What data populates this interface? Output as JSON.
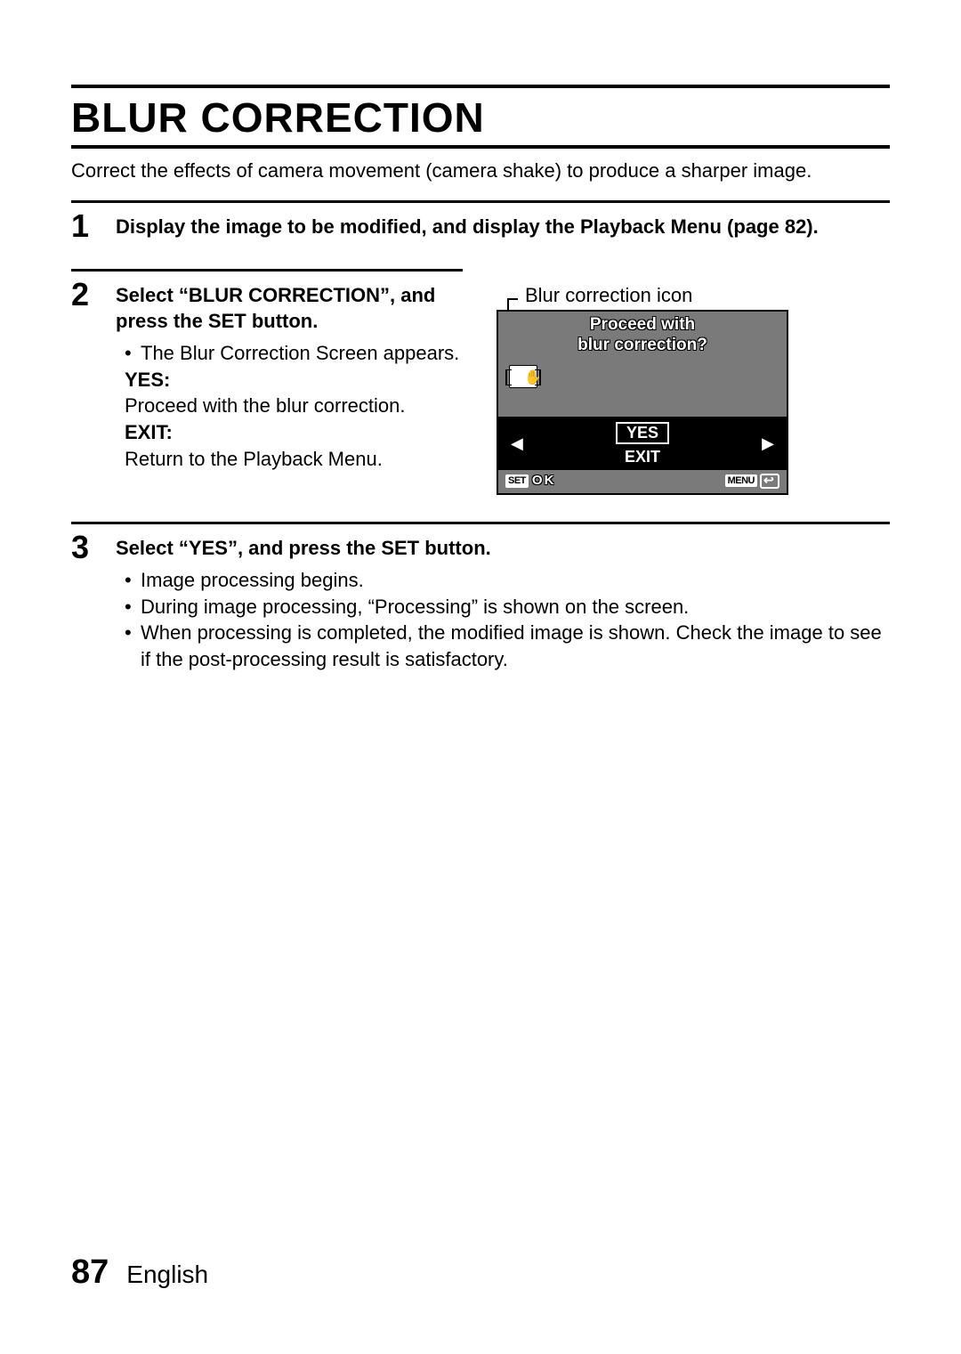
{
  "title": "BLUR CORRECTION",
  "intro": "Correct the effects of camera movement (camera shake) to produce a sharper image.",
  "steps": {
    "s1": {
      "num": "1",
      "heading": "Display the image to be modified, and display the Playback Menu (page 82)."
    },
    "s2": {
      "num": "2",
      "heading": "Select “BLUR CORRECTION”, and press the SET button.",
      "bullet1": "The Blur Correction Screen appears.",
      "yes_label": "YES:",
      "yes_text": "Proceed with the blur correction.",
      "exit_label": "EXIT:",
      "exit_text": "Return to the Playback Menu.",
      "figure_label": "Blur correction icon"
    },
    "s3": {
      "num": "3",
      "heading": "Select “YES”, and press the SET button.",
      "b1": "Image processing begins.",
      "b2": "During image processing, “Processing” is shown on the screen.",
      "b3": "When processing is completed, the modified image is shown. Check the image to see if the post-processing result is satisfactory."
    }
  },
  "screen": {
    "prompt_line1": "Proceed with",
    "prompt_line2": "blur correction?",
    "option_yes": "YES",
    "option_exit": "EXIT",
    "set_badge": "SET",
    "ok": "OK",
    "menu_badge": "MENU",
    "left_arrow": "◀",
    "right_arrow": "▶"
  },
  "footer": {
    "page": "87",
    "language": "English"
  }
}
